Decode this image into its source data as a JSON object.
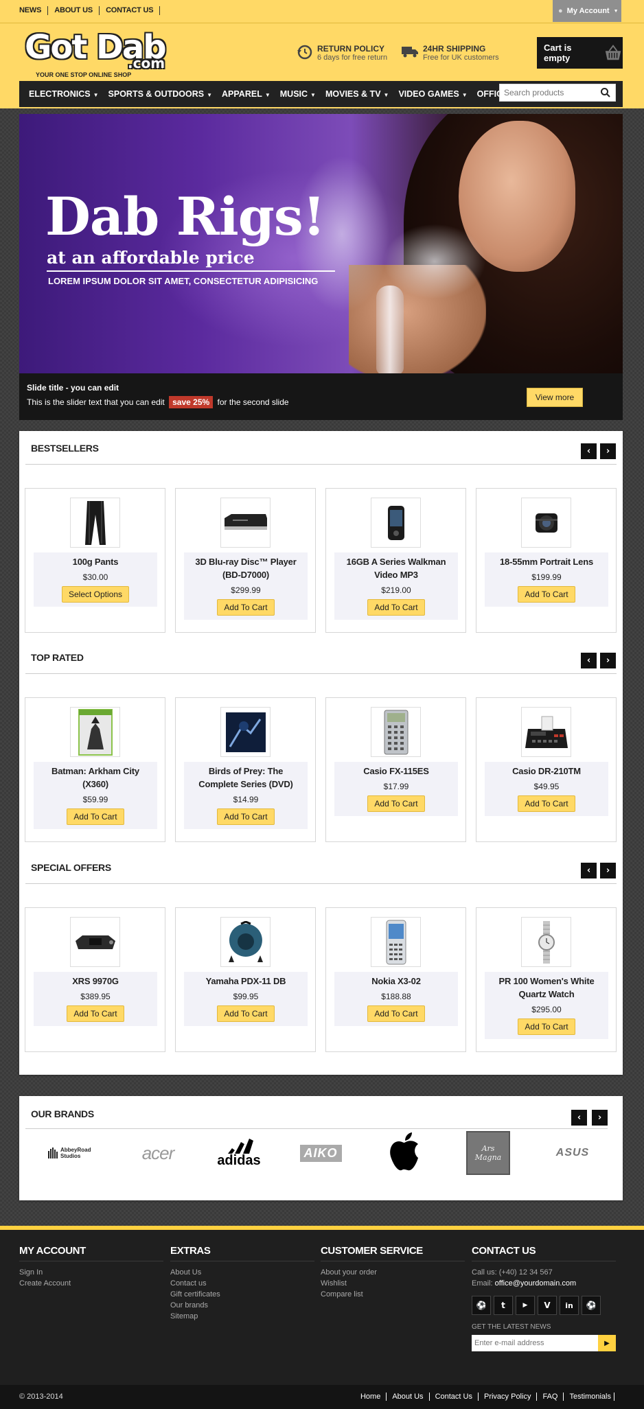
{
  "topbar": {
    "links": [
      "NEWS",
      "ABOUT US",
      "CONTACT US"
    ],
    "account_label": "My Account"
  },
  "logo": {
    "main": "Got Dab",
    "suffix": ".com",
    "tagline": "YOUR ONE STOP ONLINE SHOP"
  },
  "perks": [
    {
      "title": "RETURN POLICY",
      "subtitle": "6 days for free return",
      "icon": "undo-clock-icon"
    },
    {
      "title": "24HR SHIPPING",
      "subtitle": "Free for UK customers",
      "icon": "truck-icon"
    }
  ],
  "cart": {
    "label": "Cart is empty",
    "icon": "basket-icon"
  },
  "nav": {
    "items": [
      "ELECTRONICS",
      "SPORTS & OUTDOORS",
      "APPAREL",
      "MUSIC",
      "MOVIES & TV",
      "VIDEO GAMES",
      "OFFICE SUPPLIES"
    ]
  },
  "search": {
    "placeholder": "Search products"
  },
  "slider": {
    "headline": "Dab Rigs!",
    "subheadline": "at an affordable price",
    "tagline": "LOREM IPSUM DOLOR SIT AMET, CONSECTETUR ADIPISICING",
    "caption_title": "Slide title - you can edit",
    "caption_prefix": "This is the slider text that you can edit",
    "caption_badge": "save 25%",
    "caption_suffix": "for the second slide",
    "button": "View more"
  },
  "sections": [
    {
      "title": "BESTSELLERS",
      "products": [
        {
          "name": "100g Pants",
          "price": "$30.00",
          "button": "Select Options"
        },
        {
          "name": "3D Blu-ray Disc™ Player (BD-D7000)",
          "price": "$299.99",
          "button": "Add To Cart"
        },
        {
          "name": "16GB A Series Walkman Video MP3",
          "price": "$219.00",
          "button": "Add To Cart"
        },
        {
          "name": "18-55mm Portrait Lens",
          "price": "$199.99",
          "button": "Add To Cart"
        }
      ]
    },
    {
      "title": "TOP RATED",
      "products": [
        {
          "name": "Batman: Arkham City (X360)",
          "price": "$59.99",
          "button": "Add To Cart"
        },
        {
          "name": "Birds of Prey: The Complete Series (DVD)",
          "price": "$14.99",
          "button": "Add To Cart"
        },
        {
          "name": "Casio FX-115ES",
          "price": "$17.99",
          "button": "Add To Cart"
        },
        {
          "name": "Casio DR-210TM",
          "price": "$49.95",
          "button": "Add To Cart"
        }
      ]
    },
    {
      "title": "SPECIAL OFFERS",
      "products": [
        {
          "name": "XRS 9970G",
          "price": "$389.95",
          "button": "Add To Cart"
        },
        {
          "name": "Yamaha PDX-11 DB",
          "price": "$99.95",
          "button": "Add To Cart"
        },
        {
          "name": "Nokia X3-02",
          "price": "$188.88",
          "button": "Add To Cart"
        },
        {
          "name": "PR 100 Women's White Quartz Watch",
          "price": "$295.00",
          "button": "Add To Cart"
        }
      ]
    }
  ],
  "brands": {
    "title": "OUR BRANDS",
    "items": [
      "AbbeyRoad Studios",
      "acer",
      "adidas",
      "AIKO",
      "apple-logo",
      "Ars Magna",
      "ASUS"
    ]
  },
  "footer": {
    "my_account": {
      "title": "MY ACCOUNT",
      "links": [
        "Sign In",
        "Create Account"
      ]
    },
    "extras": {
      "title": "EXTRAS",
      "links": [
        "About Us",
        "Contact us",
        "Gift certificates",
        "Our brands",
        "Sitemap"
      ]
    },
    "customer_service": {
      "title": "CUSTOMER SERVICE",
      "links": [
        "About your order",
        "Wishlist",
        "Compare list"
      ]
    },
    "contact": {
      "title": "CONTACT US",
      "phone": "Call us: (+40) 12 34 567",
      "email_label": "Email:",
      "email": "office@yourdomain.com",
      "social": [
        "dribbble-icon",
        "twitter-icon",
        "youtube-icon",
        "vimeo-icon",
        "linkedin-icon",
        "dribbble-icon"
      ],
      "newsletter_label": "GET THE LATEST NEWS",
      "newsletter_placeholder": "Enter e-mail address"
    }
  },
  "bottombar": {
    "copyright": "© 2013-2014",
    "links": [
      "Home",
      "About Us",
      "Contact Us",
      "Privacy Policy",
      "FAQ",
      "Testimonials"
    ]
  },
  "colors": {
    "accent": "#ffd966",
    "dark": "#222222",
    "badge": "#c0392b"
  }
}
